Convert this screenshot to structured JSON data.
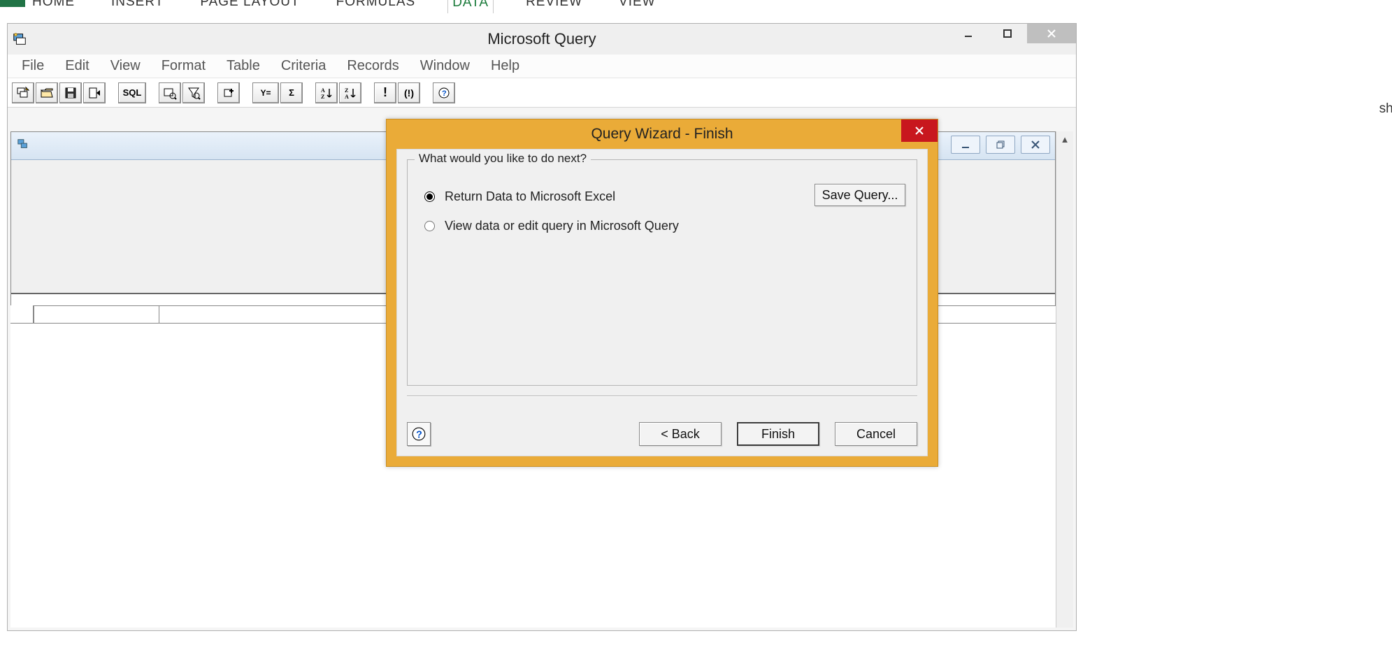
{
  "excel": {
    "tabs": [
      "HOME",
      "INSERT",
      "PAGE LAYOUT",
      "FORMULAS",
      "DATA",
      "REVIEW",
      "VIEW"
    ],
    "active_tab_index": 4,
    "right_fragment": "ships"
  },
  "mq": {
    "title": "Microsoft Query",
    "menus": [
      "File",
      "Edit",
      "View",
      "Format",
      "Table",
      "Criteria",
      "Records",
      "Window",
      "Help"
    ],
    "toolbar_sql_label": "SQL"
  },
  "wizard": {
    "title": "Query Wizard - Finish",
    "group_label": "What would you like to do next?",
    "option_return": "Return Data to Microsoft Excel",
    "option_view": "View data or edit query in Microsoft Query",
    "save_label": "Save Query...",
    "back_label": "< Back",
    "finish_label": "Finish",
    "cancel_label": "Cancel",
    "selected": "return"
  }
}
